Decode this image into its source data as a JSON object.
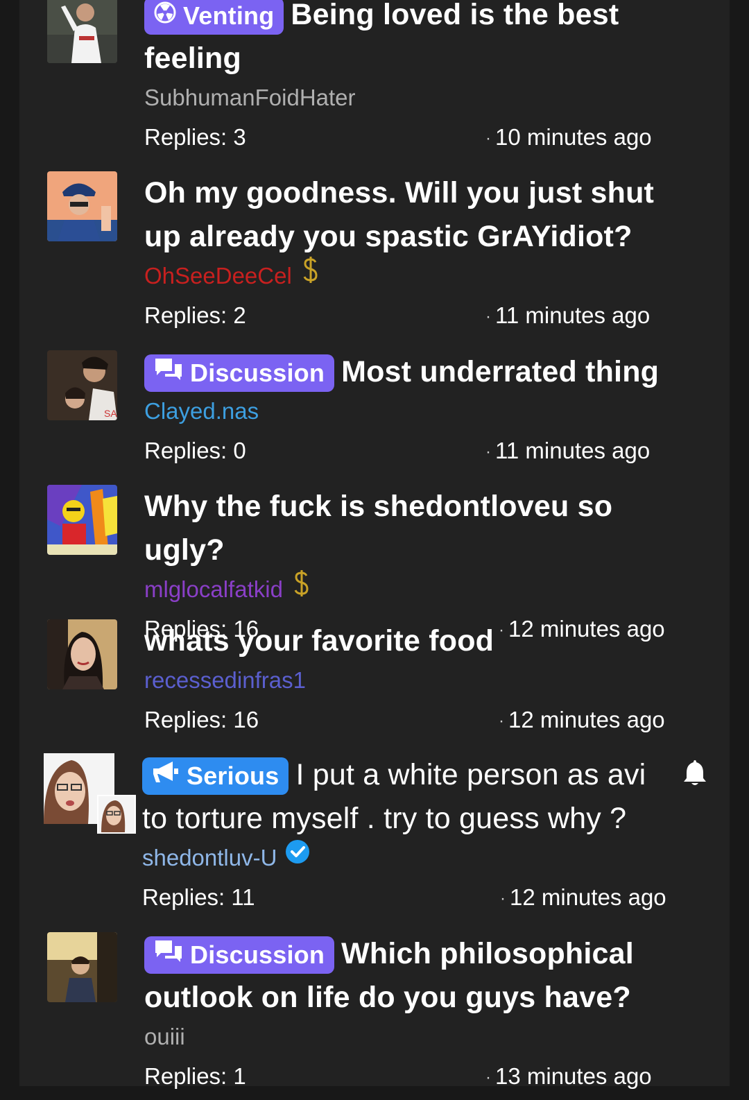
{
  "threads": [
    {
      "tag": "Venting",
      "title": "Being loved is the best feeling",
      "author": "SubhumanFoidHater",
      "replies": "Replies: 3",
      "time": "10 minutes ago",
      "author_color": "#b0b0b0"
    },
    {
      "tag": "",
      "title": "Oh my goodness. Will you just shut up already you spastic GrAYidiot?",
      "author": "OhSeeDeeCel",
      "author_badge": "$",
      "replies": "Replies: 2",
      "time": "11 minutes ago",
      "author_color": "#c8201f"
    },
    {
      "tag": "Discussion",
      "title": "Most underrated thing",
      "author": "Clayed.nas",
      "replies": "Replies: 0",
      "time": "11 minutes ago",
      "author_color": "#3d9fe0"
    },
    {
      "tag": "",
      "title": "Why the fuck is shedontloveu so ugly?",
      "author": "mlglocalfatkid",
      "author_badge": "$",
      "replies": "Replies: 16",
      "time": "12 minutes ago",
      "author_color": "#8a3fc7"
    },
    {
      "tag": "",
      "title": "whats your favorite food",
      "author": "recessedinfras1",
      "replies": "Replies: 16",
      "time": "12 minutes ago",
      "author_color": "#5b5fcf"
    },
    {
      "tag": "Serious",
      "title": "I put a white person as avi to torture myself . try to guess why ?",
      "author": "shedontluv-U",
      "replies": "Replies: 11",
      "time": "12 minutes ago",
      "author_color": "#8fb7e8"
    },
    {
      "tag": "Discussion",
      "title": "Which philosophical outlook on life do you guys have?",
      "author": "ouiii",
      "replies": "Replies: 1",
      "time": "13 minutes ago",
      "author_color": "#b0b0b0"
    }
  ],
  "colors": {
    "background": "#181818",
    "card": "#222222",
    "tag_purple": "#7b63f2",
    "tag_blue": "#2e8cf0",
    "gold_badge": "#c9a227",
    "verified": "#1d9bf0"
  },
  "icons": {
    "venting": "radioactive-icon",
    "discussion": "chat-bubbles-icon",
    "serious": "megaphone-icon",
    "money": "dollar-sign-icon",
    "verified": "verified-check-icon",
    "notify": "bell-icon"
  }
}
